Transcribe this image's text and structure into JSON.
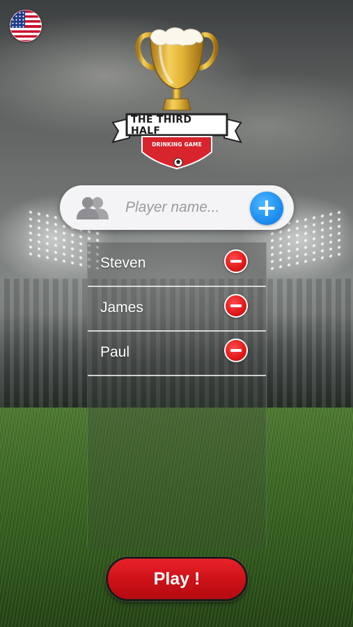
{
  "app": {
    "logo_title": "THE THIRD HALF",
    "logo_subtitle": "DRINKING GAME"
  },
  "language": {
    "flag": "us-flag"
  },
  "player_input": {
    "placeholder": "Player name...",
    "value": "",
    "people_icon": "people-icon",
    "add_icon": "plus-icon"
  },
  "players": [
    {
      "name": "Steven"
    },
    {
      "name": "James"
    },
    {
      "name": "Paul"
    }
  ],
  "actions": {
    "play_label": "Play !"
  },
  "colors": {
    "accent_blue": "#1e8ff0",
    "remove_red": "#e01818",
    "play_red": "#cc1017",
    "trophy_gold": "#e2b437"
  }
}
